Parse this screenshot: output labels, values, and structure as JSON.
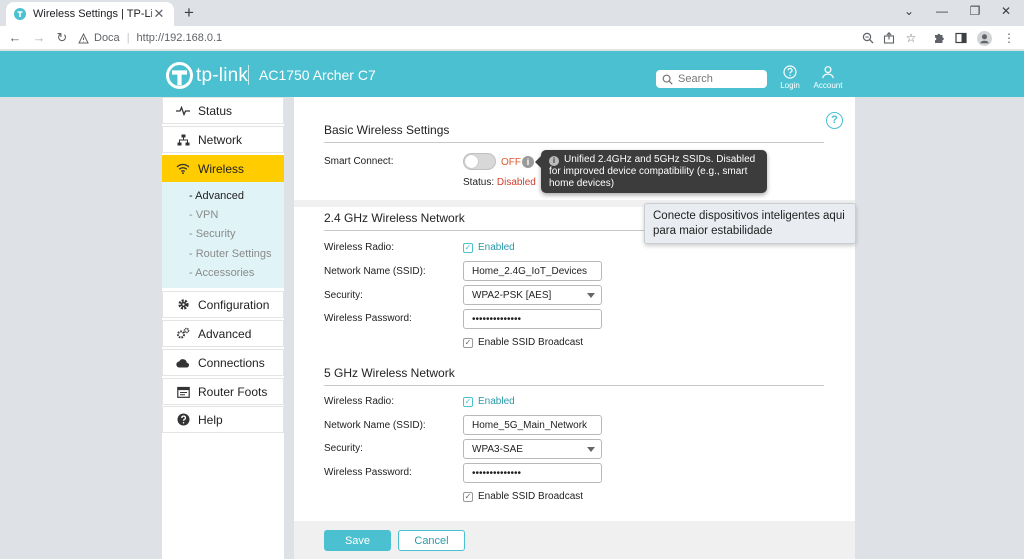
{
  "browser": {
    "tab_title": "Wireless Settings | TP-Link",
    "tab_close": "✕",
    "new_tab": "+",
    "address_prefix": "Doca",
    "address_url": "http://192.168.0.1"
  },
  "header": {
    "brand": "tp-link",
    "model": "AC1750 Archer C7",
    "search_placeholder": "Search",
    "login_label": "Login",
    "account_label": "Account"
  },
  "sidebar": {
    "items": [
      {
        "label": "Status",
        "icon": "pulse-icon"
      },
      {
        "label": "Network",
        "icon": "network-icon"
      },
      {
        "label": "Wireless",
        "icon": "wifi-icon"
      },
      {
        "label": "Configuration",
        "icon": "gear-icon"
      },
      {
        "label": "Advanced",
        "icon": "advanced-gear-icon"
      },
      {
        "label": "Connections",
        "icon": "cloud-icon"
      },
      {
        "label": "Router Foots",
        "icon": "calendar-icon"
      },
      {
        "label": "Help",
        "icon": "help-icon"
      }
    ],
    "submenu": [
      "- Advanced",
      "- VPN",
      "- Security",
      "- Router Settings",
      "- Accessories"
    ]
  },
  "basic": {
    "title": "Basic Wireless Settings",
    "smart_connect_label": "Smart Connect:",
    "toggle_text": "OFF",
    "toggle_on": false,
    "status_label": "Status:",
    "status_value": "Disabled",
    "tooltip": "Unified 2.4GHz and 5GHz SSIDs. Disabled for improved device compatibility (e.g., smart home devices)",
    "note": "Conecte dispositivos inteligentes aqui para maior estabilidade"
  },
  "band24": {
    "title": "2.4 GHz Wireless Network",
    "radio_label": "Wireless Radio:",
    "radio_value": "Enabled",
    "ssid_label": "Network Name (SSID):",
    "ssid_value": "Home_2.4G_IoT_Devices",
    "security_label": "Security:",
    "security_value": "WPA2-PSK [AES]",
    "password_label": "Wireless Password:",
    "password_value": "••••••••••••••",
    "broadcast_label": "Enable SSID Broadcast"
  },
  "band5": {
    "title": "5 GHz Wireless Network",
    "radio_label": "Wireless Radio:",
    "radio_value": "Enabled",
    "ssid_label": "Network Name (SSID):",
    "ssid_value": "Home_5G_Main_Network",
    "security_label": "Security:",
    "security_value": "WPA3-SAE",
    "password_label": "Wireless Password:",
    "password_value": "••••••••••••••",
    "broadcast_label": "Enable SSID Broadcast"
  },
  "actions": {
    "save_label": "Save",
    "cancel_label": "Cancel"
  },
  "colors": {
    "brand": "#4ac0d0",
    "active_menu": "#ffcc00",
    "status_disabled": "#d0402b"
  }
}
